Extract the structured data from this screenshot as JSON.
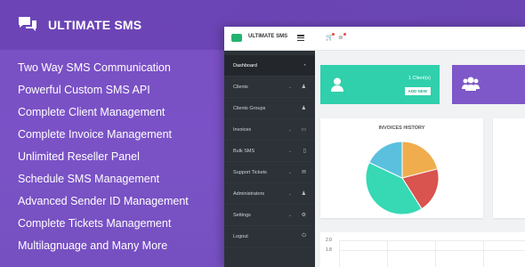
{
  "brand": {
    "name": "ULTIMATE SMS",
    "icon": "chat-bubbles-icon"
  },
  "features": [
    "Two Way SMS Communication",
    "Powerful Custom SMS API",
    "Complete Client Management",
    "Complete Invoice Management",
    "Unlimited Reseller Panel",
    "Schedule SMS Management",
    "Advanced Sender ID Management",
    "Complete Tickets Management",
    "Multilagnuage and Many More"
  ],
  "app": {
    "topbar": {
      "brand": "ULTIMATE SMS"
    },
    "sidebar": [
      {
        "label": "Dashboard",
        "icon": "dashboard-icon",
        "has_chevron": false,
        "active": true
      },
      {
        "label": "Clients",
        "icon": "user-icon",
        "has_chevron": true
      },
      {
        "label": "Clients Groups",
        "icon": "users-icon",
        "has_chevron": false
      },
      {
        "label": "Invoices",
        "icon": "credit-card-icon",
        "has_chevron": true
      },
      {
        "label": "Bulk SMS",
        "icon": "mobile-icon",
        "has_chevron": true
      },
      {
        "label": "Support Tickets",
        "icon": "envelope-icon",
        "has_chevron": true
      },
      {
        "label": "Administrators",
        "icon": "user-icon",
        "has_chevron": true
      },
      {
        "label": "Settings",
        "icon": "cogs-icon",
        "has_chevron": true
      },
      {
        "label": "Logout",
        "icon": "power-icon",
        "has_chevron": false
      }
    ],
    "clients_card": {
      "count": "1 Client(s)",
      "button": "ADD NEW"
    },
    "invoices_history": {
      "title": "INVOICES HISTORY"
    },
    "bottom_chart": {
      "y_ticks": [
        "2.0",
        "1.8"
      ]
    },
    "colors": {
      "green": "#30d0ac",
      "purple": "#7e57c8",
      "sidebar": "#2d3238"
    }
  },
  "chart_data": {
    "type": "pie",
    "title": "INVOICES HISTORY",
    "values": [
      21,
      20,
      41,
      18
    ],
    "colors": [
      "#f0ad4e",
      "#d9534f",
      "#36d9b4",
      "#5bc0de"
    ]
  }
}
